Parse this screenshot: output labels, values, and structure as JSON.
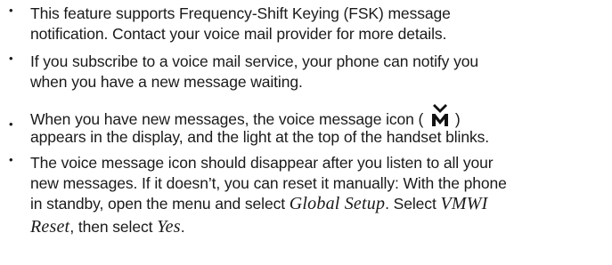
{
  "bullet_glyph": "•",
  "bullets": [
    {
      "lines": [
        "This feature supports Frequency-Shift Keying (FSK) message",
        "notification. Contact your voice mail provider for more details."
      ]
    },
    {
      "lines": [
        "If you subscribe to a voice mail service, your phone can notify you",
        "when you have a new message waiting."
      ]
    },
    {
      "line1_before_icon": "When you have new messages, the voice message icon (",
      "icon": "voice-message-icon",
      "line1_after_icon": ")",
      "line2": "appears in the display, and the light at the top of the handset blinks."
    },
    {
      "line1": "The voice message icon should disappear after you listen to all your",
      "line2": "new messages. If it doesn’t, you can reset it manually: With the phone",
      "line3_before": "in standby, open the menu and select ",
      "line3_menu": "Global Setup",
      "line3_after": ". Select ",
      "line3_menu2": "VMWI",
      "line4_menu": "Reset",
      "line4_middle": ", then select ",
      "line4_menu2": "Yes",
      "line4_end": "."
    }
  ]
}
